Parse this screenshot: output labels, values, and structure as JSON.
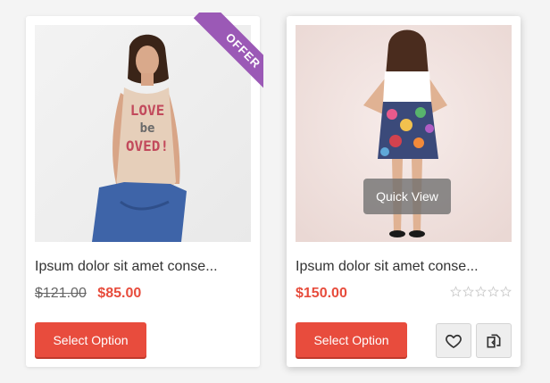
{
  "products": [
    {
      "badge": "OFFER",
      "title": "Ipsum dolor sit amet conse...",
      "old_price": "$121.00",
      "price": "$85.00",
      "button_label": "Select Option",
      "shirt_text": [
        "LOVE",
        "be",
        "OVED!"
      ]
    },
    {
      "title": "Ipsum dolor sit amet conse...",
      "price": "$150.00",
      "quick_view_label": "Quick View",
      "button_label": "Select Option",
      "rating": 0,
      "rating_max": 5,
      "actions": [
        "heart-icon",
        "compare-icon"
      ]
    }
  ],
  "colors": {
    "sale_price": "#e74c3c",
    "button": "#e84c3d",
    "ribbon": "#9b59b6",
    "star_empty": "#cccccc"
  }
}
